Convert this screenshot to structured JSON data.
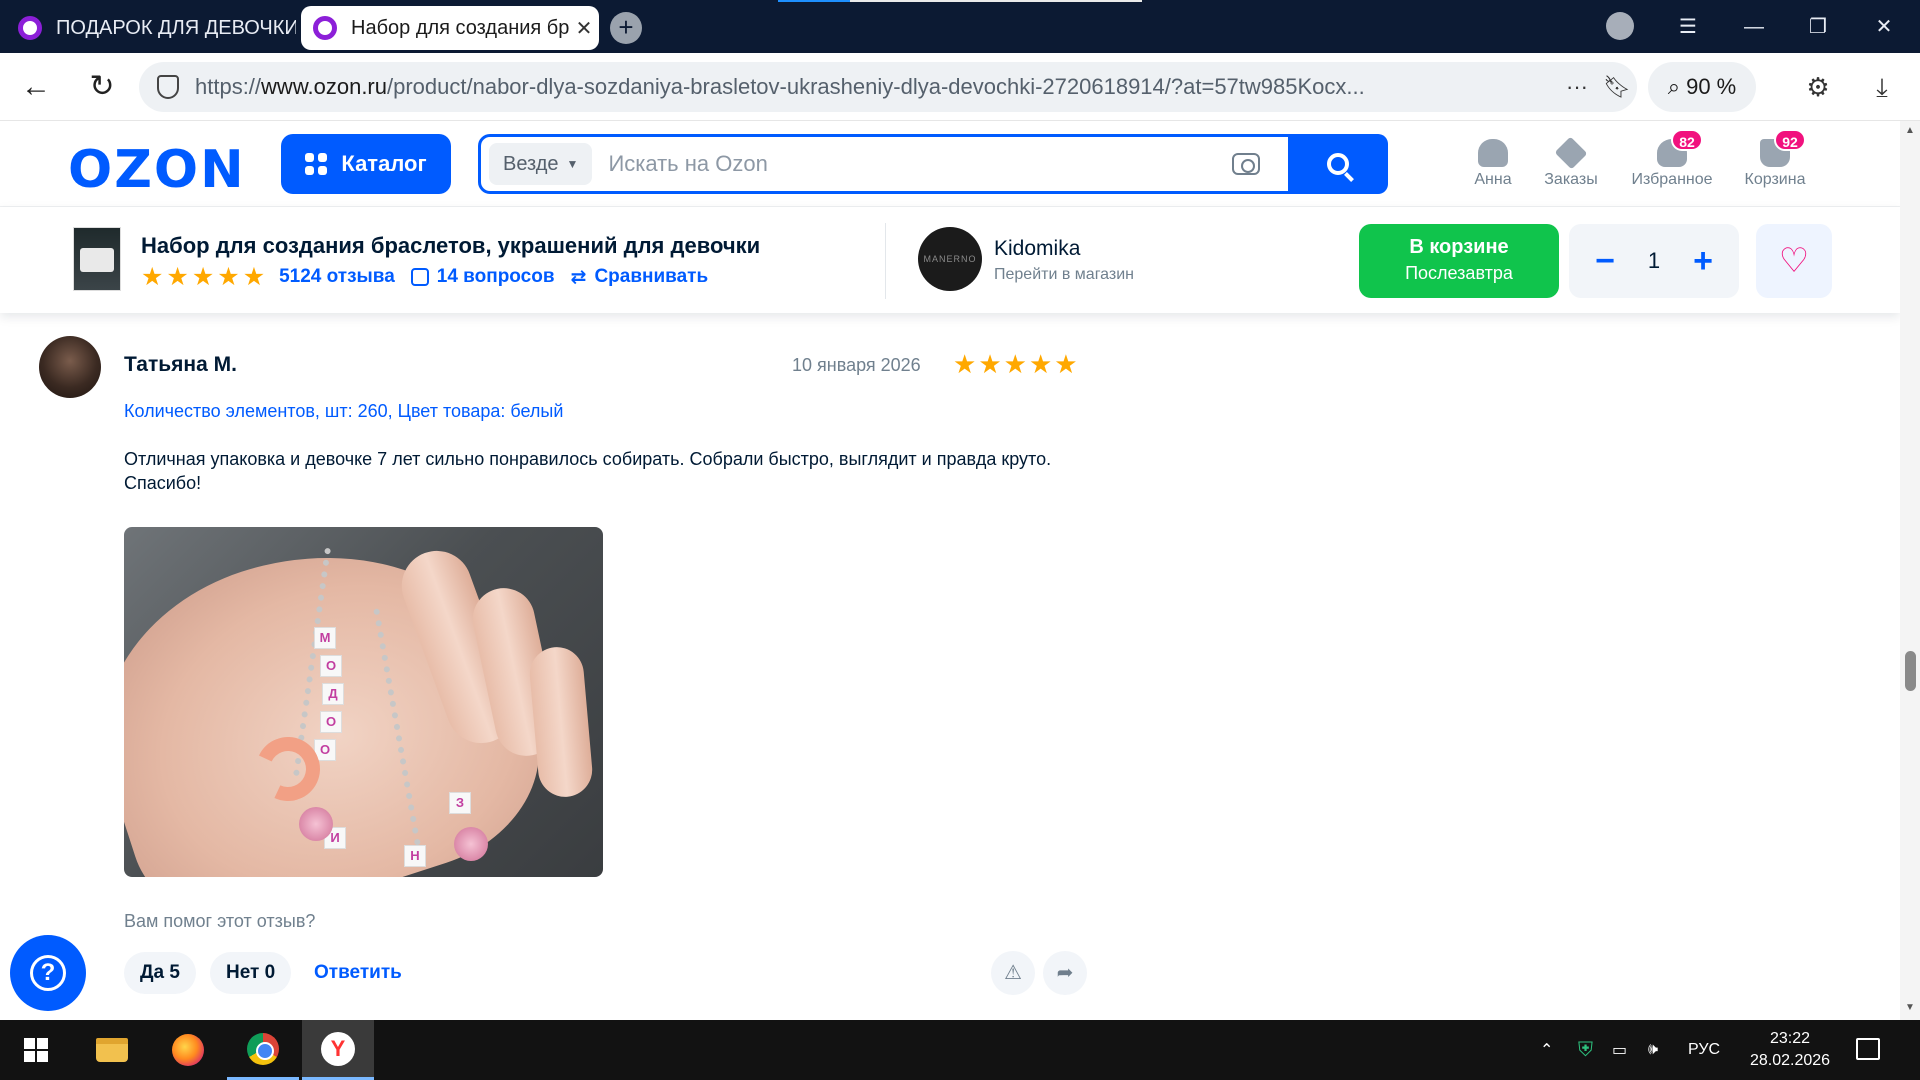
{
  "browser": {
    "tabs": [
      {
        "title": "ПОДАРОК ДЛЯ ДЕВОЧКИ",
        "active": false
      },
      {
        "title": "Набор для создания браслетов",
        "active": true
      }
    ],
    "tab_close": "✕",
    "new_tab": "+",
    "url_prefix": "https://",
    "url_domain": "www.ozon.ru",
    "url_path": "/product/nabor-dlya-sozdaniya-brasletov-ukrasheniy-dlya-devochki-2720618914/?at=57tw985Kocx...",
    "zoom": "90 %",
    "controls": {
      "menu": "☰",
      "minimize": "—",
      "restore": "❐",
      "close": "✕"
    }
  },
  "ozon": {
    "logo": "OZON",
    "catalog_label": "Каталог",
    "search_scope": "Везде",
    "search_placeholder": "Искать на Ozon",
    "header_items": [
      {
        "label": "Анна",
        "badge": ""
      },
      {
        "label": "Заказы",
        "badge": ""
      },
      {
        "label": "Избранное",
        "badge": "82"
      },
      {
        "label": "Корзина",
        "badge": "92"
      }
    ]
  },
  "product": {
    "title": "Набор для создания браслетов, украшений для девочки",
    "rating_stars": 5,
    "reviews_link": "5124 отзыва",
    "questions_link": "14 вопросов",
    "compare_link": "Сравнивать",
    "shop_name": "Kidomika",
    "shop_link": "Перейти в магазин",
    "shop_logo_text": "MANERNO",
    "cart_status": "В корзине",
    "cart_delivery": "Послезавтра",
    "quantity": "1",
    "minus": "−",
    "plus": "+",
    "favorite_icon": "♡"
  },
  "review": {
    "author": "Татьяна М.",
    "date": "10 января 2026",
    "stars": 5,
    "variant": "Количество элементов, шт: 260, Цвет товара: белый",
    "text": "Отличная упаковка и девочке 7 лет сильно понравилось собирать. Собрали быстро, выглядит и правда круто. Спасибо!",
    "helpful_question": "Вам помог этот отзыв?",
    "yes_label": "Да 5",
    "no_label": "Нет 0",
    "reply_label": "Ответить"
  },
  "help_icon": "?",
  "taskbar": {
    "language": "РУС",
    "time": "23:22",
    "date": "28.02.2026"
  },
  "colors": {
    "ozon_blue": "#005bff",
    "cart_green": "#10c44c",
    "badge_pink": "#f1117e",
    "star": "#ffa800"
  }
}
